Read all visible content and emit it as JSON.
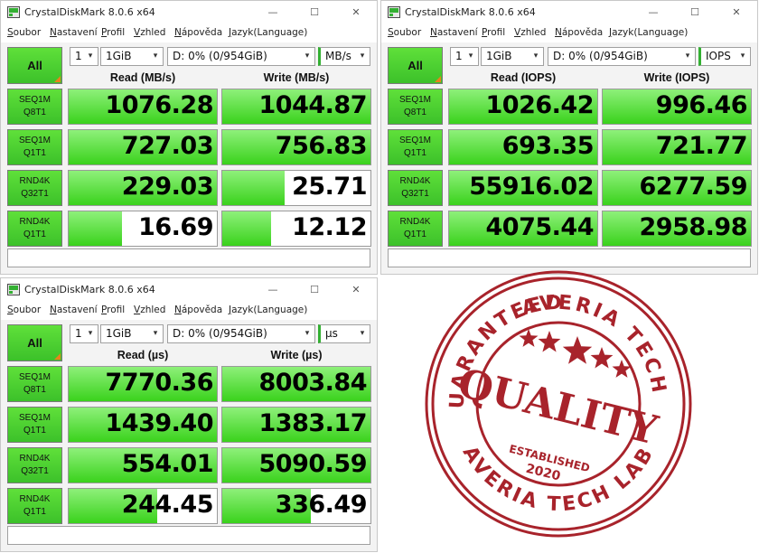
{
  "app_title": "CrystalDiskMark 8.0.6 x64",
  "menu": [
    {
      "ul": "S",
      "rest": "oubor"
    },
    {
      "ul": "N",
      "rest": "astavení"
    },
    {
      "ul": "P",
      "rest": "rofil"
    },
    {
      "ul": "V",
      "rest": "zhled"
    },
    {
      "ul": "N",
      "rest": "ápověda"
    },
    {
      "ul": "J",
      "rest": "azyk(Language)"
    }
  ],
  "all_label": "All",
  "window_controls": {
    "minimize": "—",
    "maximize": "☐",
    "close": "✕"
  },
  "windows": [
    {
      "count": "1",
      "size": "1GiB",
      "drive": "D: 0% (0/954GiB)",
      "unit": "MB/s",
      "read_head": "Read (MB/s)",
      "write_head": "Write (MB/s)",
      "rows": [
        {
          "l1": "SEQ1M",
          "l2": "Q8T1",
          "read": "1076.28",
          "write": "1044.87",
          "read_fill": 1.0,
          "write_fill": 1.0
        },
        {
          "l1": "SEQ1M",
          "l2": "Q1T1",
          "read": "727.03",
          "write": "756.83",
          "read_fill": 1.0,
          "write_fill": 1.0
        },
        {
          "l1": "RND4K",
          "l2": "Q32T1",
          "read": "229.03",
          "write": "25.71",
          "read_fill": 1.0,
          "write_fill": 0.42
        },
        {
          "l1": "RND4K",
          "l2": "Q1T1",
          "read": "16.69",
          "write": "12.12",
          "read_fill": 0.36,
          "write_fill": 0.33
        }
      ]
    },
    {
      "count": "1",
      "size": "1GiB",
      "drive": "D: 0% (0/954GiB)",
      "unit": "IOPS",
      "read_head": "Read (IOPS)",
      "write_head": "Write (IOPS)",
      "rows": [
        {
          "l1": "SEQ1M",
          "l2": "Q8T1",
          "read": "1026.42",
          "write": "996.46",
          "read_fill": 1.0,
          "write_fill": 1.0
        },
        {
          "l1": "SEQ1M",
          "l2": "Q1T1",
          "read": "693.35",
          "write": "721.77",
          "read_fill": 1.0,
          "write_fill": 1.0
        },
        {
          "l1": "RND4K",
          "l2": "Q32T1",
          "read": "55916.02",
          "write": "6277.59",
          "read_fill": 1.0,
          "write_fill": 1.0
        },
        {
          "l1": "RND4K",
          "l2": "Q1T1",
          "read": "4075.44",
          "write": "2958.98",
          "read_fill": 1.0,
          "write_fill": 1.0
        }
      ]
    },
    {
      "count": "1",
      "size": "1GiB",
      "drive": "D: 0% (0/954GiB)",
      "unit": "µs",
      "read_head": "Read (µs)",
      "write_head": "Write (µs)",
      "rows": [
        {
          "l1": "SEQ1M",
          "l2": "Q8T1",
          "read": "7770.36",
          "write": "8003.84",
          "read_fill": 1.0,
          "write_fill": 1.0
        },
        {
          "l1": "SEQ1M",
          "l2": "Q1T1",
          "read": "1439.40",
          "write": "1383.17",
          "read_fill": 1.0,
          "write_fill": 1.0
        },
        {
          "l1": "RND4K",
          "l2": "Q32T1",
          "read": "554.01",
          "write": "5090.59",
          "read_fill": 1.0,
          "write_fill": 1.0
        },
        {
          "l1": "RND4K",
          "l2": "Q1T1",
          "read": "244.45",
          "write": "336.49",
          "read_fill": 0.6,
          "write_fill": 0.6
        }
      ]
    }
  ],
  "stamp": {
    "top_text": "GUARANTEED",
    "right_text": "AVERIA TECH LAB",
    "bottom_text": "AVERIA TECH LAB",
    "center_text": "QUALITY",
    "established": "ESTABLISHED",
    "year": "2020",
    "color": "#a8232b"
  }
}
